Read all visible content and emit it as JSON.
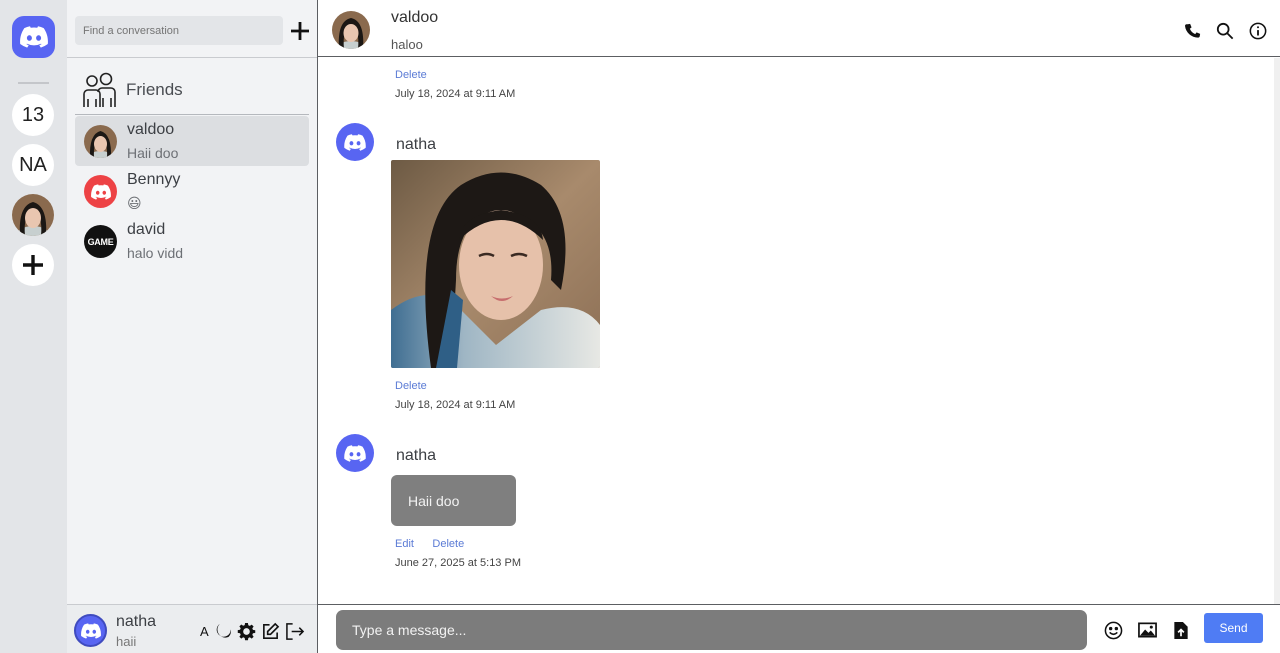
{
  "colors": {
    "brand": "#5865f2",
    "send": "#4f7cf4",
    "bubble": "#7f7f7f",
    "bennyy": "#ed4245"
  },
  "rail": {
    "logo_icon": "discord-logo-icon",
    "items": [
      {
        "label": "13"
      },
      {
        "label": "NA"
      },
      {
        "icon": "profile-photo"
      },
      {
        "icon": "plus-icon"
      }
    ]
  },
  "sidebar": {
    "search_placeholder": "Find a conversation",
    "friends_label": "Friends",
    "conversations": [
      {
        "name": "valdoo",
        "preview": "Haii doo",
        "active": true
      },
      {
        "name": "Bennyy",
        "preview": "😃",
        "active": false
      },
      {
        "name": "david",
        "preview": "halo vidd",
        "active": false,
        "avatar_text": "GAME"
      }
    ]
  },
  "user_panel": {
    "name": "natha",
    "status": "haii",
    "font_toggle": "A",
    "tools": [
      "font-size-icon",
      "moon-icon",
      "gear-icon",
      "edit-icon",
      "logout-icon"
    ]
  },
  "chat": {
    "header": {
      "name": "valdoo",
      "status": "haloo",
      "icons": [
        "phone-icon",
        "search-icon",
        "info-icon"
      ]
    },
    "messages": [
      {
        "type": "partial",
        "actions": [
          "Delete"
        ],
        "timestamp": "July 18, 2024 at 9:11 AM"
      },
      {
        "type": "image",
        "author": "natha",
        "actions": [
          "Delete"
        ],
        "timestamp": "July 18, 2024 at 9:11 AM"
      },
      {
        "type": "text",
        "author": "natha",
        "text": "Haii doo",
        "actions": [
          "Edit",
          "Delete"
        ],
        "timestamp": "June 27, 2025 at 5:13 PM"
      }
    ]
  },
  "composer": {
    "placeholder": "Type a message...",
    "icons": [
      "emoji-icon",
      "image-icon",
      "file-upload-icon"
    ],
    "send_label": "Send"
  }
}
